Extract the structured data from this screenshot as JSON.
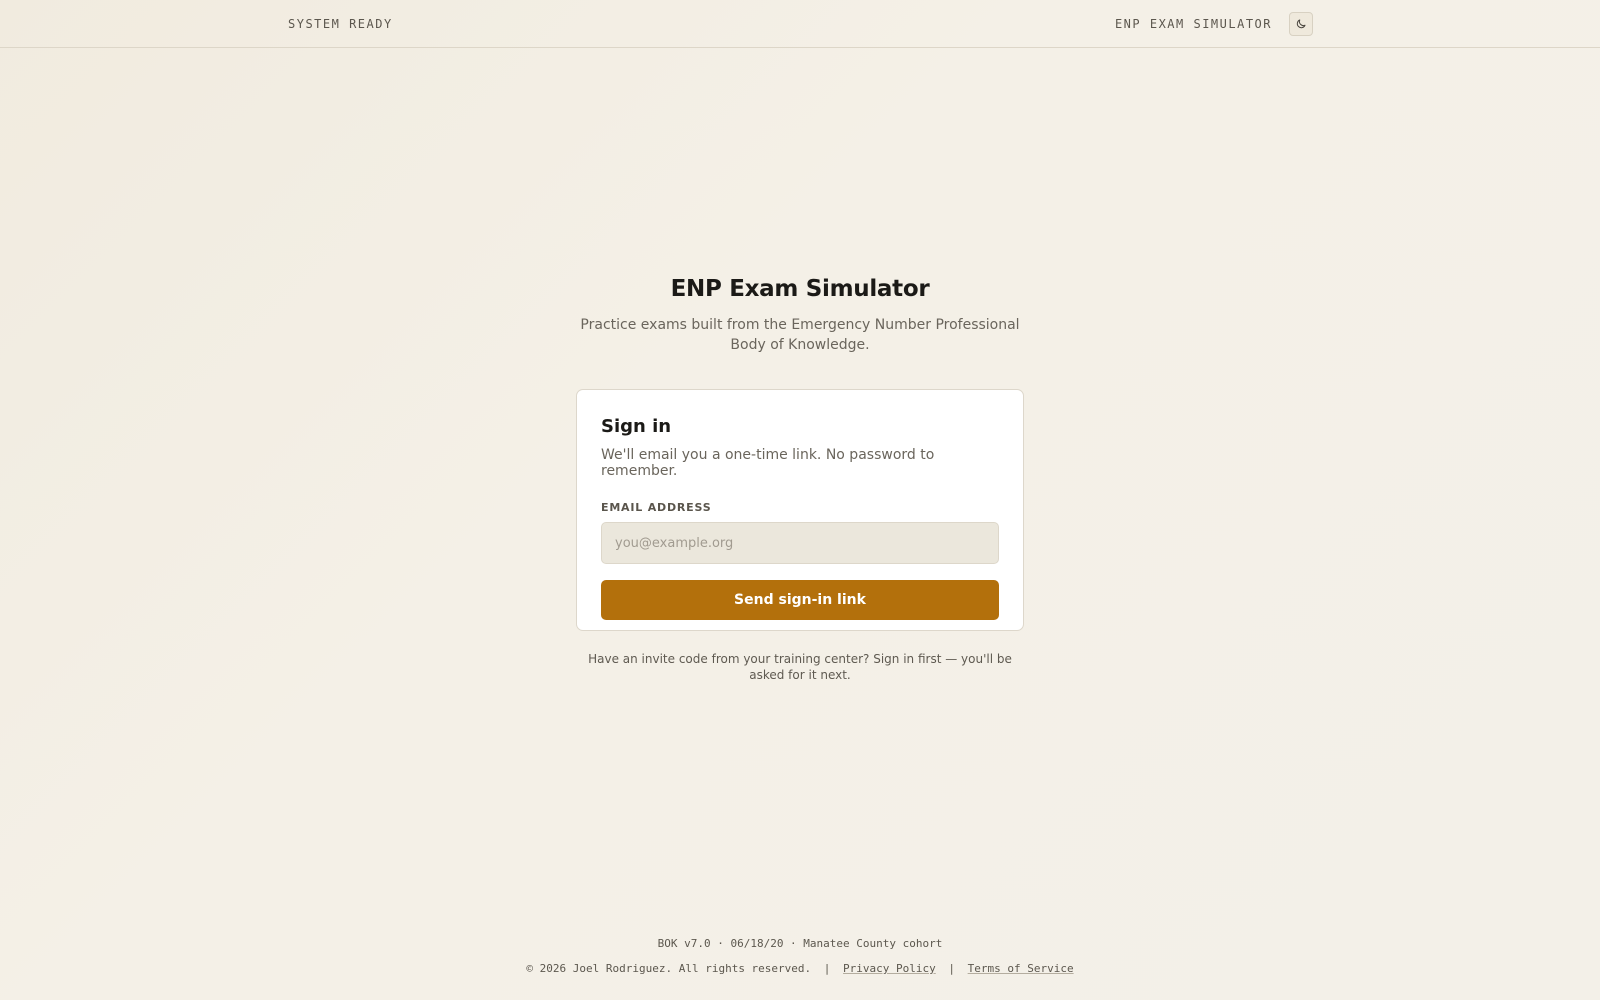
{
  "header": {
    "status": "SYSTEM READY",
    "brand": "ENP EXAM SIMULATOR",
    "theme_icon": "moon-icon"
  },
  "hero": {
    "title": "ENP Exam Simulator",
    "subtitle": "Practice exams built from the Emergency Number Professional Body of Knowledge."
  },
  "signin": {
    "title": "Sign in",
    "subtitle": "We'll email you a one-time link. No password to remember.",
    "email_label": "EMAIL ADDRESS",
    "email_placeholder": "you@example.org",
    "email_value": "",
    "submit_label": "Send sign-in link"
  },
  "invite_note": "Have an invite code from your training center? Sign in first — you'll be asked for it next.",
  "footer": {
    "meta": "BOK v7.0 · 06/18/20 · Manatee County cohort",
    "copyright": "© 2026 Joel Rodriguez. All rights reserved.",
    "separator": "|",
    "privacy": "Privacy Policy",
    "terms": "Terms of Service"
  },
  "colors": {
    "accent": "#b3700c",
    "background": "#f3efe6",
    "card": "#ffffff"
  }
}
